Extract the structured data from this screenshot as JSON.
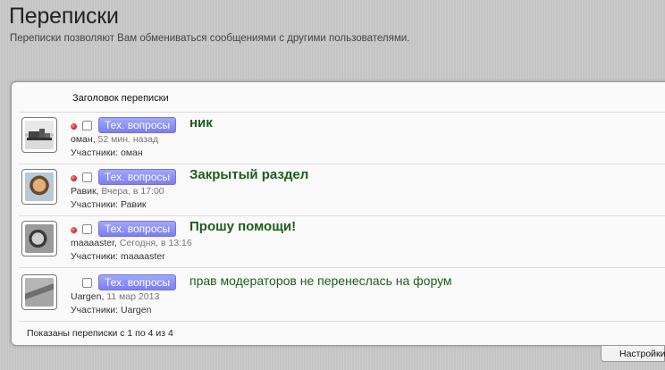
{
  "page": {
    "title": "Переписки",
    "description": "Переписки позволяют Вам обмениваться сообщениями с другими пользователями."
  },
  "list": {
    "column_header": "Заголовок переписки",
    "footer": "Показаны переписки с 1 по 4 из 4",
    "rows": [
      {
        "prefix": "Тех. вопросы",
        "title": "ник",
        "author": "оман",
        "date": "52 мин. назад",
        "participants": "Участники: оман",
        "unread": true
      },
      {
        "prefix": "Тех. вопросы",
        "title": "Закрытый раздел",
        "author": "Равик",
        "date": "Вчера, в 17:00",
        "participants": "Участники: Равик",
        "unread": true
      },
      {
        "prefix": "Тех. вопросы",
        "title": "Прошу помощи!",
        "author": "maaaaster",
        "date": "Сегодня, в 13:16",
        "participants": "Участники: maaaaster",
        "unread": true
      },
      {
        "prefix": "Тех. вопросы",
        "title": "прав модераторов не перенеслась на форум",
        "author": "Uargen",
        "date": "11 мар 2013",
        "participants": "Участники: Uargen",
        "unread": false
      }
    ]
  },
  "settings": {
    "label": "Настройки"
  },
  "colors": {
    "title_link": "#1e5c1e",
    "prefix_bg": "#8c8ff5",
    "unread_dot": "#c81d1d"
  }
}
